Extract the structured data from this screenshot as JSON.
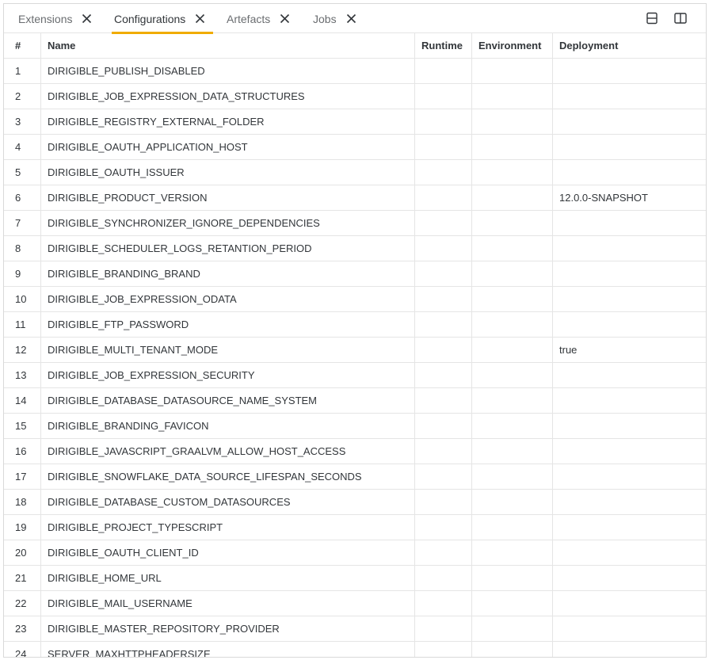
{
  "tabs": [
    {
      "label": "Extensions"
    },
    {
      "label": "Configurations"
    },
    {
      "label": "Artefacts"
    },
    {
      "label": "Jobs"
    }
  ],
  "active_tab": "Configurations",
  "colors": {
    "accent": "#f0ab00",
    "border": "#e5e5e5"
  },
  "toolbar": {
    "icons": [
      "split-horizontal-icon",
      "split-vertical-icon"
    ]
  },
  "table": {
    "headers": {
      "num": "#",
      "name": "Name",
      "runtime": "Runtime",
      "environment": "Environment",
      "deployment": "Deployment"
    },
    "rows": [
      {
        "num": "1",
        "name": "DIRIGIBLE_PUBLISH_DISABLED",
        "runtime": "",
        "environment": "",
        "deployment": ""
      },
      {
        "num": "2",
        "name": "DIRIGIBLE_JOB_EXPRESSION_DATA_STRUCTURES",
        "runtime": "",
        "environment": "",
        "deployment": ""
      },
      {
        "num": "3",
        "name": "DIRIGIBLE_REGISTRY_EXTERNAL_FOLDER",
        "runtime": "",
        "environment": "",
        "deployment": ""
      },
      {
        "num": "4",
        "name": "DIRIGIBLE_OAUTH_APPLICATION_HOST",
        "runtime": "",
        "environment": "",
        "deployment": ""
      },
      {
        "num": "5",
        "name": "DIRIGIBLE_OAUTH_ISSUER",
        "runtime": "",
        "environment": "",
        "deployment": ""
      },
      {
        "num": "6",
        "name": "DIRIGIBLE_PRODUCT_VERSION",
        "runtime": "",
        "environment": "",
        "deployment": "12.0.0-SNAPSHOT"
      },
      {
        "num": "7",
        "name": "DIRIGIBLE_SYNCHRONIZER_IGNORE_DEPENDENCIES",
        "runtime": "",
        "environment": "",
        "deployment": ""
      },
      {
        "num": "8",
        "name": "DIRIGIBLE_SCHEDULER_LOGS_RETANTION_PERIOD",
        "runtime": "",
        "environment": "",
        "deployment": ""
      },
      {
        "num": "9",
        "name": "DIRIGIBLE_BRANDING_BRAND",
        "runtime": "",
        "environment": "",
        "deployment": ""
      },
      {
        "num": "10",
        "name": "DIRIGIBLE_JOB_EXPRESSION_ODATA",
        "runtime": "",
        "environment": "",
        "deployment": ""
      },
      {
        "num": "11",
        "name": "DIRIGIBLE_FTP_PASSWORD",
        "runtime": "",
        "environment": "",
        "deployment": ""
      },
      {
        "num": "12",
        "name": "DIRIGIBLE_MULTI_TENANT_MODE",
        "runtime": "",
        "environment": "",
        "deployment": "true"
      },
      {
        "num": "13",
        "name": "DIRIGIBLE_JOB_EXPRESSION_SECURITY",
        "runtime": "",
        "environment": "",
        "deployment": ""
      },
      {
        "num": "14",
        "name": "DIRIGIBLE_DATABASE_DATASOURCE_NAME_SYSTEM",
        "runtime": "",
        "environment": "",
        "deployment": ""
      },
      {
        "num": "15",
        "name": "DIRIGIBLE_BRANDING_FAVICON",
        "runtime": "",
        "environment": "",
        "deployment": ""
      },
      {
        "num": "16",
        "name": "DIRIGIBLE_JAVASCRIPT_GRAALVM_ALLOW_HOST_ACCESS",
        "runtime": "",
        "environment": "",
        "deployment": ""
      },
      {
        "num": "17",
        "name": "DIRIGIBLE_SNOWFLAKE_DATA_SOURCE_LIFESPAN_SECONDS",
        "runtime": "",
        "environment": "",
        "deployment": ""
      },
      {
        "num": "18",
        "name": "DIRIGIBLE_DATABASE_CUSTOM_DATASOURCES",
        "runtime": "",
        "environment": "",
        "deployment": ""
      },
      {
        "num": "19",
        "name": "DIRIGIBLE_PROJECT_TYPESCRIPT",
        "runtime": "",
        "environment": "",
        "deployment": ""
      },
      {
        "num": "20",
        "name": "DIRIGIBLE_OAUTH_CLIENT_ID",
        "runtime": "",
        "environment": "",
        "deployment": ""
      },
      {
        "num": "21",
        "name": "DIRIGIBLE_HOME_URL",
        "runtime": "",
        "environment": "",
        "deployment": ""
      },
      {
        "num": "22",
        "name": "DIRIGIBLE_MAIL_USERNAME",
        "runtime": "",
        "environment": "",
        "deployment": ""
      },
      {
        "num": "23",
        "name": "DIRIGIBLE_MASTER_REPOSITORY_PROVIDER",
        "runtime": "",
        "environment": "",
        "deployment": ""
      },
      {
        "num": "24",
        "name": "SERVER_MAXHTTPHEADERSIZE",
        "runtime": "",
        "environment": "",
        "deployment": ""
      }
    ]
  }
}
